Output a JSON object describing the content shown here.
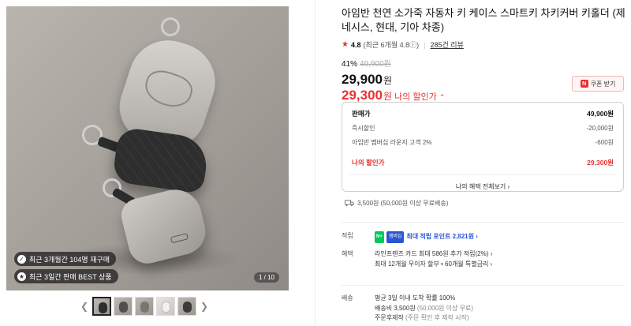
{
  "gallery": {
    "badges": [
      {
        "icon": "verified-icon",
        "text": "최근 3개월간 104명 재구매"
      },
      {
        "icon": "best-icon",
        "text": "최근 3일간 판매 BEST 상품"
      }
    ],
    "counter": "1 / 10",
    "thumb_count": 5,
    "prev_arrow": "❮",
    "next_arrow": "❯"
  },
  "product": {
    "title": "아임반 천연 소가죽 자동차 키 케이스 스마트키 차키커버 키홀더 (제네시스, 현대, 기아 차종)",
    "rating": "4.8",
    "rating_recent": "(최근 6개월 4.8ⓘ)",
    "reviews": "285건 리뷰",
    "discount_rate": "41%",
    "original_price": "49,900원",
    "price": "29,900",
    "price_unit": "원",
    "my_price": "29,300",
    "my_price_unit": "원",
    "my_price_label": "나의 할인가",
    "my_price_chevron": "⌃",
    "coupon_icon": "N",
    "coupon": "쿠폰 받기"
  },
  "price_box": {
    "rows": [
      {
        "label": "판매가",
        "value": "49,900원"
      },
      {
        "label": "즉시할인",
        "value": "-20,000원"
      },
      {
        "label": "아임반 멤버십 라운지 고객 2%",
        "value": "-600원"
      }
    ],
    "final": {
      "label": "나의 할인가",
      "value": "29,300원"
    },
    "more": "나의 혜택 전체보기 ›"
  },
  "shipping_summary": "3,500원 (50,000원 이상 무료배송)",
  "sections": {
    "points": {
      "key": "적립",
      "n_badge": "N+",
      "membership": "멤버십",
      "text": "최대 적립 포인트 2,821원 ›"
    },
    "benefits": {
      "key": "혜택",
      "line1": "라인프렌즈 카드 최대 586원 추가 적립(2%) ›",
      "line2": "최대 12개월 무이자 할부 • 60개월 특별금리 ›"
    },
    "delivery": {
      "key": "배송",
      "line1": "평균 3일 이내 도착 확률 100%",
      "line2_a": "배송비 3,500원",
      "line2_b": " (50,000원 이상 무료)",
      "line3_a": "주문후제작",
      "line3_b": " (주문 확인 후 제작 시작)"
    }
  },
  "colors": {
    "accent": "#e8312f",
    "point_blue": "#2a56d3",
    "naver_green": "#03c75a"
  }
}
